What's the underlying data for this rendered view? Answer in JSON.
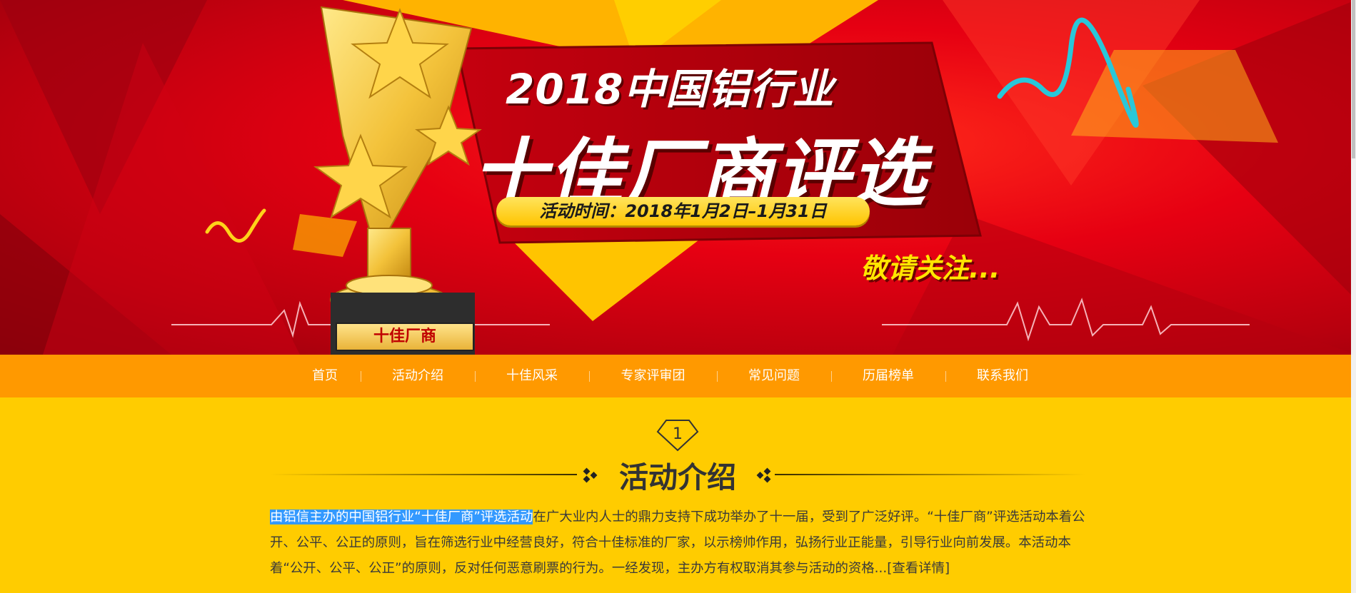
{
  "banner": {
    "title_year": "2018中国铝行业",
    "title_main": "十佳厂商评选",
    "date_text": "活动时间：2018年1月2日–1月31日",
    "attention_text": "敬请关注...",
    "trophy_plaque": "十佳厂商",
    "colors": {
      "red": "#e60012",
      "gold": "#ffc400",
      "accent_yellow": "#ffe600"
    }
  },
  "nav": {
    "items": [
      {
        "label": "首页"
      },
      {
        "label": "活动介绍"
      },
      {
        "label": "十佳风采"
      },
      {
        "label": "专家评审团"
      },
      {
        "label": "常见问题"
      },
      {
        "label": "历届榜单"
      },
      {
        "label": "联系我们"
      }
    ],
    "background": "#ff9900"
  },
  "intro": {
    "badge_number": "1",
    "title": "活动介绍",
    "highlighted_text": "由铝信主办的中国铝行业“十佳厂商”评选活动",
    "body_text": "在广大业内人士的鼎力支持下成功举办了十一届，受到了广泛好评。“十佳厂商”评选活动本着公开、公平、公正的原则，旨在筛选行业中经营良好，符合十佳标准的厂家，以示榜帅作用，弘扬行业正能量，引导行业向前发展。本活动本着“公开、公平、公正”的原则，反对任何恶意刷票的行为。一经发现，主办方有权取消其参与活动的资格...",
    "more_link": "[查看详情]",
    "background": "#ffcc00",
    "selection_color": "#3399ff"
  }
}
